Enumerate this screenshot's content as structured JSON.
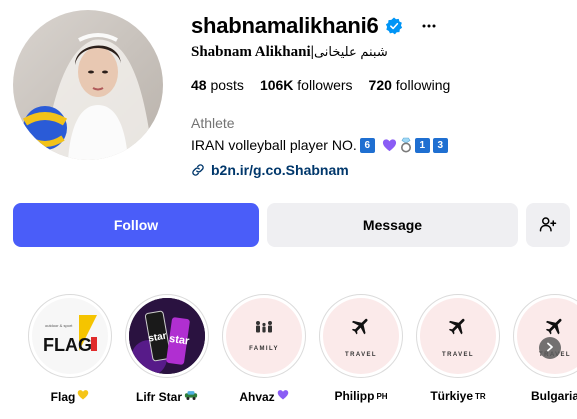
{
  "profile": {
    "username": "shabnamalikhani6",
    "full_name_latin": "Shabnam Alikhani|",
    "full_name_fa": "شبنم علیخانی",
    "stats": {
      "posts_count": "48",
      "posts_label": "posts",
      "followers_count": "106K",
      "followers_label": "followers",
      "following_count": "720",
      "following_label": "following"
    },
    "category": "Athlete",
    "bio_text": "IRAN volleyball player NO.",
    "bio_num_1": "6",
    "bio_num_2": "1",
    "bio_num_3": "3",
    "link": "b2n.ir/g.co.Shabnam"
  },
  "actions": {
    "follow_label": "Follow",
    "message_label": "Message"
  },
  "highlights": [
    {
      "label": "Flag",
      "emoji": "yellow-heart",
      "icon": "flag-logo"
    },
    {
      "label": "Lifr Star",
      "emoji": "recycle-car",
      "icon": "star-drink"
    },
    {
      "label": "Ahvaz",
      "emoji": "purple-heart",
      "icon": "family",
      "sub": "FAMILY"
    },
    {
      "label": "Philipp",
      "suffix": "PH",
      "icon": "airplane-icon",
      "sub": "TRAVEL"
    },
    {
      "label": "Türkiye",
      "suffix": "TR",
      "icon": "airplane-icon",
      "sub": "TRAVEL"
    },
    {
      "label": "Bulgaria",
      "icon": "airplane-icon",
      "sub": "TRAVEL"
    }
  ],
  "colors": {
    "follow_bg": "#4a5df9",
    "secondary_bg": "#efeff2",
    "link": "#00376b",
    "verified": "#0095f6",
    "category": "#737373",
    "highlight_pink": "#fbeaea"
  }
}
